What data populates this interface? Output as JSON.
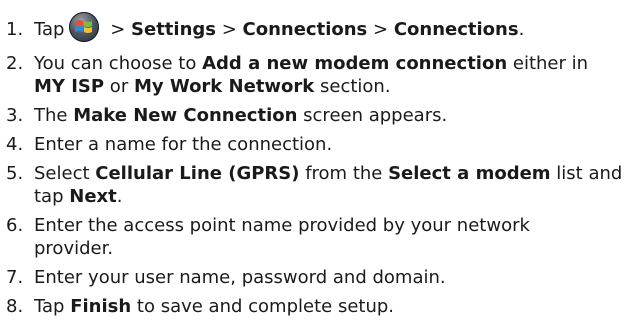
{
  "steps": [
    {
      "num": "1.",
      "parts": [
        "Tap",
        " > ",
        "Settings",
        " > ",
        "Connections",
        " > ",
        "Connections",
        "."
      ],
      "icon": "windows-start-icon"
    },
    {
      "num": "2.",
      "line1": [
        "You can choose to ",
        "Add a new modem connection",
        " either in"
      ],
      "line2": [
        "MY ISP",
        " or ",
        "My Work Network",
        " section."
      ]
    },
    {
      "num": "3.",
      "parts": [
        "The ",
        "Make New Connection",
        " screen appears."
      ]
    },
    {
      "num": "4.",
      "text": "Enter a name for the connection."
    },
    {
      "num": "5.",
      "line1": [
        "Select ",
        "Cellular Line (GPRS)",
        " from the ",
        "Select a modem",
        " list and"
      ],
      "line2": [
        "tap ",
        "Next",
        "."
      ]
    },
    {
      "num": "6.",
      "line1": "Enter the access point name provided by your network",
      "line2": "provider."
    },
    {
      "num": "7.",
      "text": "Enter your user name, password and domain."
    },
    {
      "num": "8.",
      "parts": [
        "Tap ",
        "Finish",
        " to save and complete setup."
      ]
    }
  ]
}
